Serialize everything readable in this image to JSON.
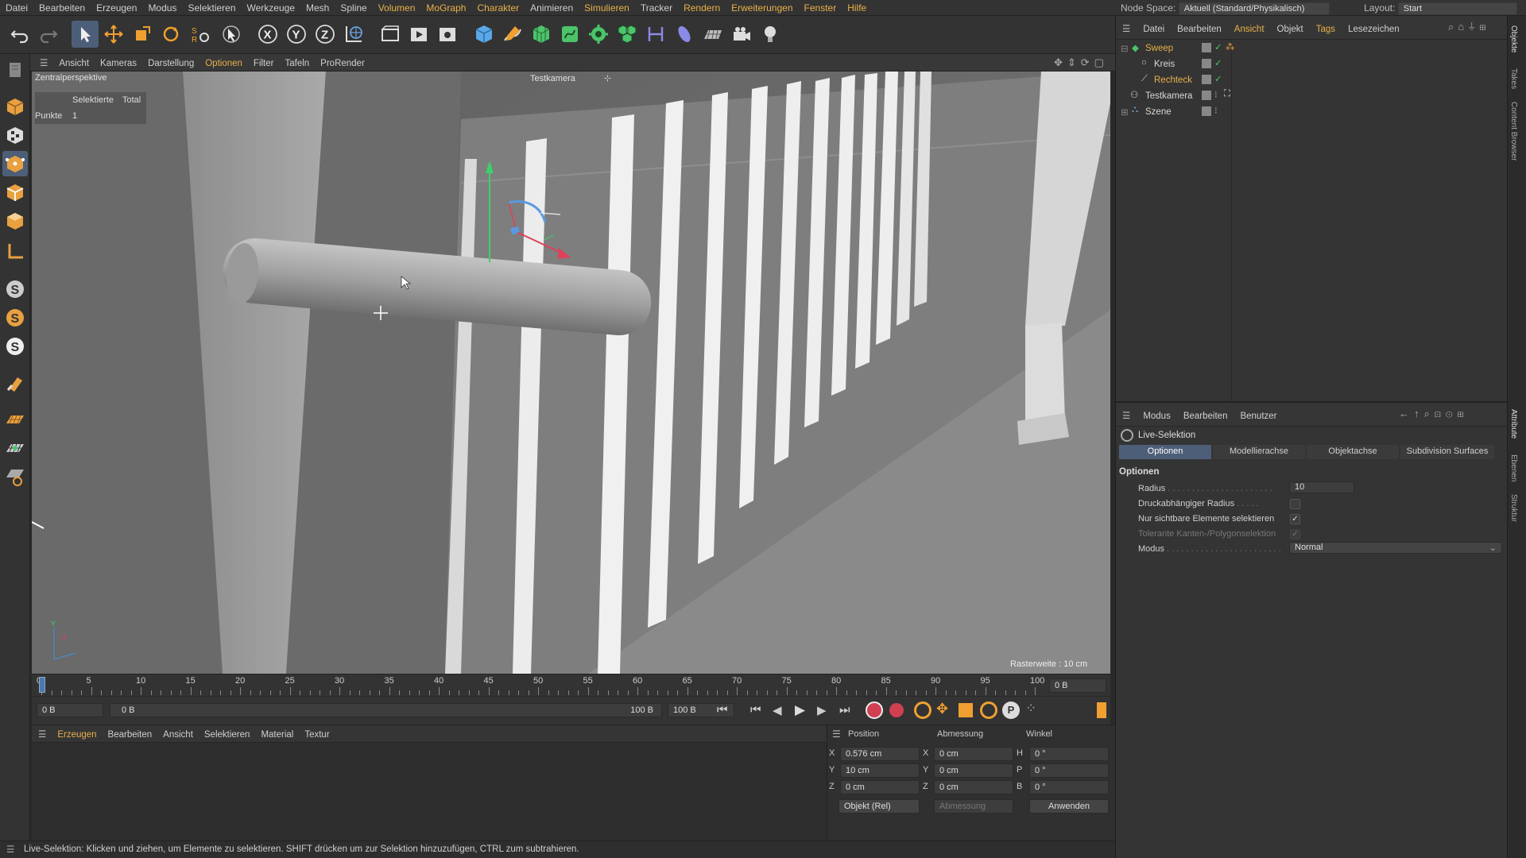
{
  "menubar": {
    "items": [
      "Datei",
      "Bearbeiten",
      "Erzeugen",
      "Modus",
      "Selektieren",
      "Werkzeuge",
      "Mesh",
      "Spline",
      "Volumen",
      "MoGraph",
      "Charakter",
      "Animieren",
      "Simulieren",
      "Tracker",
      "Rendern",
      "Erweiterungen",
      "Fenster",
      "Hilfe"
    ],
    "node_space_label": "Node Space:",
    "node_space_value": "Aktuell (Standard/Physikalisch)",
    "layout_label": "Layout:",
    "layout_value": "Start"
  },
  "toolbar": {
    "icons": [
      "undo-icon",
      "redo-icon",
      "select-icon",
      "move-icon",
      "scale-icon",
      "rotate-icon",
      "recent-tools-icon",
      "live-select-icon",
      "x-axis-icon",
      "y-axis-icon",
      "z-axis-icon",
      "world-coord-icon",
      "render-region-icon",
      "render-view-icon",
      "render-settings-icon",
      "cube-icon",
      "pen-icon",
      "subdivision-icon",
      "spline-generator-icon",
      "array-icon",
      "mograph-cloner-icon",
      "deformer-icon",
      "field-icon",
      "floor-icon",
      "camera-icon",
      "light-icon"
    ],
    "axis_labels": [
      "X",
      "Y",
      "Z"
    ]
  },
  "viewport": {
    "menu": [
      "Ansicht",
      "Kameras",
      "Darstellung",
      "Optionen",
      "Filter",
      "Tafeln",
      "ProRender"
    ],
    "projection": "Zentralperspektive",
    "camera": "Testkamera",
    "stats": {
      "col1": "Selektierte",
      "col2": "Total",
      "row_label": "Punkte",
      "row_value": "1"
    },
    "grid_spacing": "Rasterweite : 10 cm"
  },
  "timeline": {
    "ticks": [
      "0",
      "5",
      "10",
      "15",
      "20",
      "25",
      "30",
      "35",
      "40",
      "45",
      "50",
      "55",
      "60",
      "65",
      "70",
      "75",
      "80",
      "85",
      "90",
      "95",
      "100"
    ],
    "current_frame": "0 B"
  },
  "transport": {
    "start": "0 B",
    "range_start": "0 B",
    "range_end": "100 B",
    "end": "100 B"
  },
  "material_panel": {
    "menu": [
      "Erzeugen",
      "Bearbeiten",
      "Ansicht",
      "Selektieren",
      "Material",
      "Textur"
    ]
  },
  "coords": {
    "headers": [
      "Position",
      "Abmessung",
      "Winkel"
    ],
    "rows": [
      {
        "axis": "X",
        "pos": "0.576 cm",
        "dim_axis": "X",
        "dim": "0 cm",
        "ang_axis": "H",
        "ang": "0 °"
      },
      {
        "axis": "Y",
        "pos": "10 cm",
        "dim_axis": "Y",
        "dim": "0 cm",
        "ang_axis": "P",
        "ang": "0 °"
      },
      {
        "axis": "Z",
        "pos": "0 cm",
        "dim_axis": "Z",
        "dim": "0 cm",
        "ang_axis": "B",
        "ang": "0 °"
      }
    ],
    "mode": "Objekt (Rel)",
    "size_mode": "Abmessung",
    "apply": "Anwenden"
  },
  "status": "Live-Selektion: Klicken und ziehen, um Elemente zu selektieren. SHIFT drücken um zur Selektion hinzuzufügen, CTRL zum subtrahieren.",
  "objects": {
    "menu": [
      "Datei",
      "Bearbeiten",
      "Ansicht",
      "Objekt",
      "Tags",
      "Lesezeichen"
    ],
    "items": [
      {
        "name": "Sweep",
        "color": "#e8b04a"
      },
      {
        "name": "Kreis",
        "color": "#d8d8d8"
      },
      {
        "name": "Rechteck",
        "color": "#e8b04a"
      },
      {
        "name": "Testkamera",
        "color": "#d8d8d8"
      },
      {
        "name": "Szene",
        "color": "#d8d8d8"
      }
    ]
  },
  "attributes": {
    "menu": [
      "Modus",
      "Bearbeiten",
      "Benutzer"
    ],
    "tool": "Live-Selektion",
    "tabs": [
      "Optionen",
      "Modellierachse",
      "Objektachse",
      "Subdivision Surfaces"
    ],
    "section": "Optionen",
    "radius_label": "Radius",
    "radius_value": "10",
    "pressure_label": "Druckabhängiger Radius",
    "visible_label": "Nur sichtbare Elemente selektieren",
    "tolerant_label": "Tolerante Kanten-/Polygonselektion",
    "mode_label": "Modus",
    "mode_value": "Normal"
  },
  "side_tabs": [
    "Objekte",
    "Takes",
    "Content Browser",
    "Attribute",
    "Ebenen",
    "Struktur"
  ],
  "colors": {
    "accent": "#e8b04a",
    "active_blue": "#4d5f78",
    "panel": "#343434"
  }
}
